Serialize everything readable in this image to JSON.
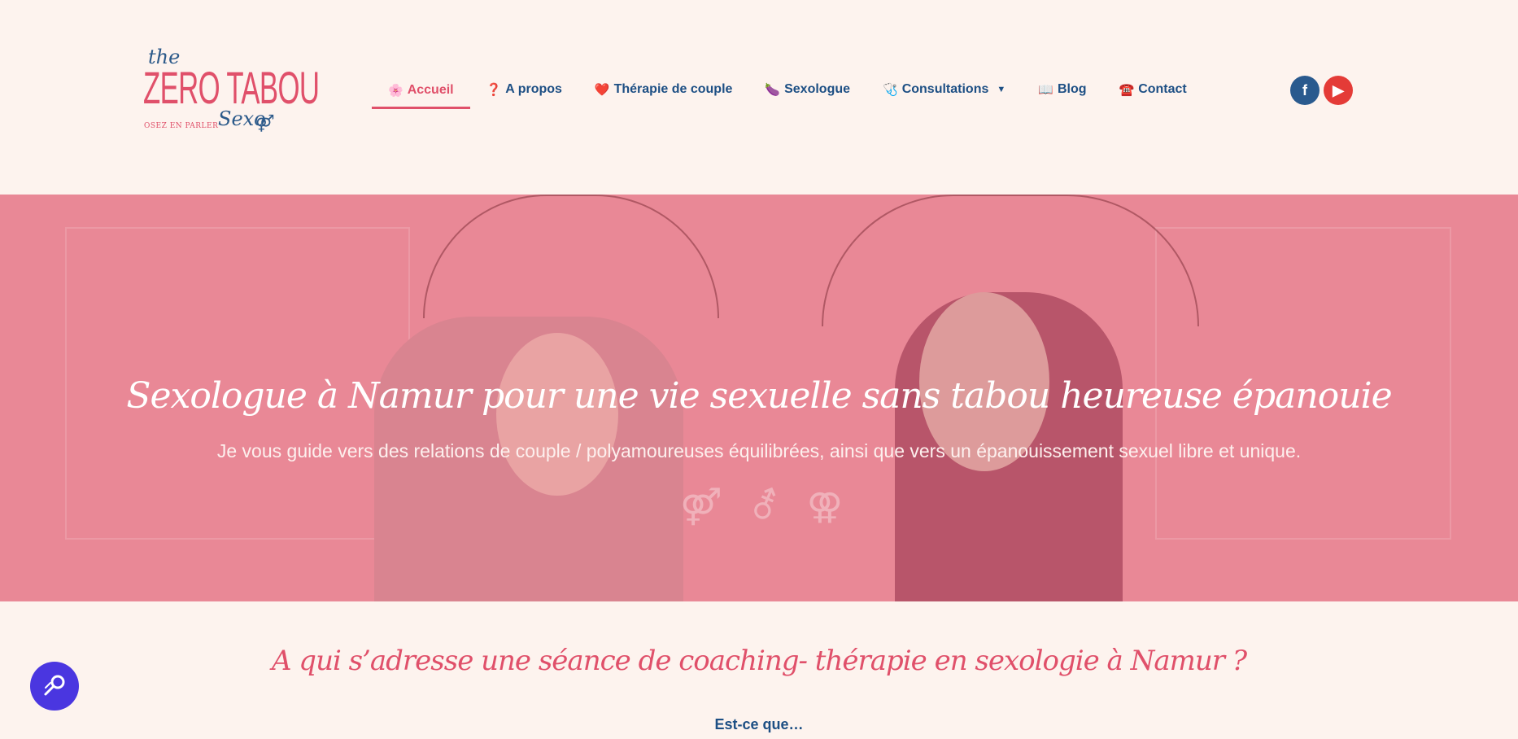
{
  "logo": {
    "the": "the",
    "brand": "ZERO TABOU",
    "tagline": "OSEZ EN PARLER",
    "sexo": "Sexo",
    "symbol": "⚤"
  },
  "nav": {
    "items": [
      {
        "emoji": "🌸",
        "label": "Accueil",
        "active": true
      },
      {
        "emoji": "❓",
        "label": "A propos"
      },
      {
        "emoji": "❤️",
        "label": "Thérapie de couple"
      },
      {
        "emoji": "🍆",
        "label": "Sexologue"
      },
      {
        "emoji": "🩺",
        "label": "Consultations",
        "caret": "▼"
      },
      {
        "emoji": "📖",
        "label": "Blog"
      },
      {
        "emoji": "☎️",
        "label": "Contact"
      }
    ]
  },
  "social": {
    "facebook": "f",
    "youtube": "▶"
  },
  "hero": {
    "title": "Sexologue à Namur pour une vie sexuelle sans tabou heureuse épanouie",
    "subtitle": "Je vous guide vers des relations de couple / polyamoureuses équilibrées, ainsi que vers un épanouissement sexuel libre et unique.",
    "icons": [
      "⚤",
      "⚦",
      "⚢"
    ]
  },
  "section": {
    "title": "A qui s’adresse une séance de coaching- thérapie en sexologie à Namur ?",
    "intro": "Est-ce que…"
  },
  "accessibility": {
    "icon": "accessibility-icon"
  },
  "colors": {
    "brand_pink": "#e0506a",
    "brand_blue": "#1d4f84",
    "background": "#fdf3ee",
    "hero_overlay": "#e98896",
    "facebook": "#2a5a8e",
    "youtube": "#e43b37",
    "a11y_button": "#4a36e0"
  }
}
